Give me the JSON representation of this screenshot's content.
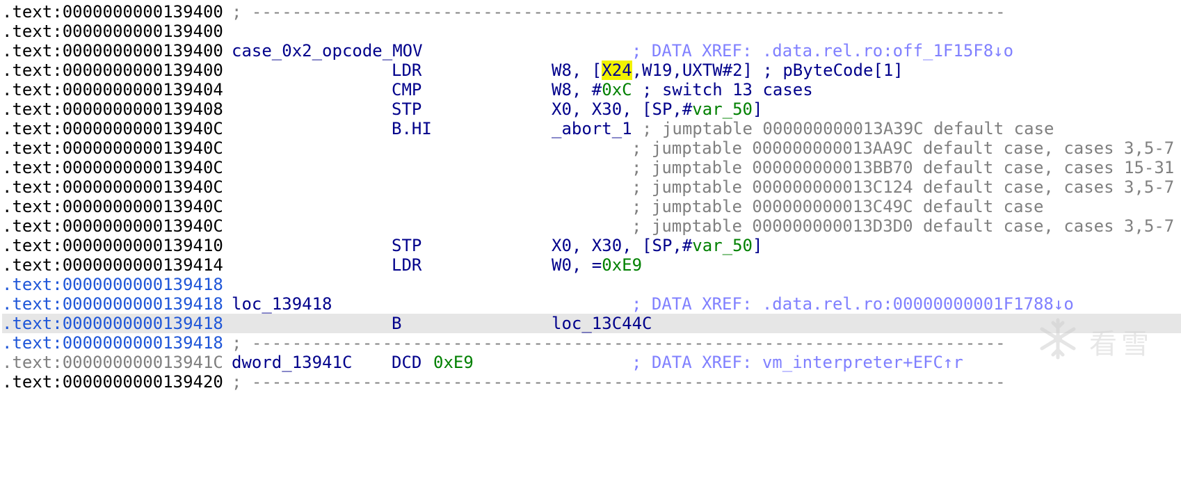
{
  "listing": {
    "rows": [
      {
        "addr": ".text:0000000000139400",
        "sep": "; ---------------------------------------------------------------------------"
      },
      {
        "addr": ".text:0000000000139400"
      },
      {
        "addr": ".text:0000000000139400",
        "label": "case_0x2_opcode_MOV",
        "comment": "; DATA XREF: .data.rel.ro:off_1F15F8↓o"
      },
      {
        "addr": ".text:0000000000139400",
        "mnem": "LDR",
        "ops_a": "W8, [",
        "ops_hl": "X24",
        "ops_b": ",W19,UXTW#2]",
        "ops_cmt": " ; pByteCode[1]"
      },
      {
        "addr": ".text:0000000000139404",
        "mnem": "CMP",
        "ops_a": "W8, #",
        "ops_num": "0xC",
        "ops_cmt": " ; switch 13 cases"
      },
      {
        "addr": ".text:0000000000139408",
        "mnem": "STP",
        "ops_a": "X0, X30, [SP,#",
        "ops_var": "var_50",
        "ops_b": "]"
      },
      {
        "addr": ".text:000000000013940C",
        "mnem": "B.HI",
        "ops_a": "_abort_1",
        "ops_cmt": " ; jumptable 000000000013A39C default case"
      },
      {
        "addr": ".text:000000000013940C",
        "comment": "; jumptable 000000000013AA9C default case, cases 3,5-7"
      },
      {
        "addr": ".text:000000000013940C",
        "comment": "; jumptable 000000000013BB70 default case, cases 15-31"
      },
      {
        "addr": ".text:000000000013940C",
        "comment": "; jumptable 000000000013C124 default case, cases 3,5-7"
      },
      {
        "addr": ".text:000000000013940C",
        "comment": "; jumptable 000000000013C49C default case"
      },
      {
        "addr": ".text:000000000013940C",
        "comment": "; jumptable 000000000013D3D0 default case, cases 3,5-7"
      },
      {
        "addr": ".text:0000000000139410",
        "mnem": "STP",
        "ops_a": "X0, X30, [SP,#",
        "ops_var": "var_50",
        "ops_b": "]"
      },
      {
        "addr": ".text:0000000000139414",
        "mnem": "LDR",
        "ops_a": "W0, =",
        "ops_num": "0xE9"
      },
      {
        "addr": ".text:0000000000139418"
      },
      {
        "addr": ".text:0000000000139418",
        "label": "loc_139418",
        "comment": "; DATA XREF: .data.rel.ro:00000000001F1788↓o"
      },
      {
        "addr": ".text:0000000000139418",
        "mnem": "B",
        "ops_a": "loc_13C44C"
      },
      {
        "addr": ".text:0000000000139418",
        "sep": "; ---------------------------------------------------------------------------"
      },
      {
        "addr": ".text:000000000013941C",
        "label": "dword_13941C",
        "mnem": "DCD",
        "ops_a": "0xE9",
        "comment": "; DATA XREF: vm_interpreter+EFC↑r"
      },
      {
        "addr": ".text:0000000000139420",
        "sep": "; ---------------------------------------------------------------------------"
      }
    ]
  },
  "watermark": {
    "text": "看雪",
    "icon": "snowflake-icon"
  },
  "colors": {
    "address_black": "#000000",
    "address_blue": "#1f56d8",
    "address_gray": "#7f7f7f",
    "code_navy": "#00008b",
    "number_green": "#008000",
    "xref_purple": "#8080ff",
    "comment_gray": "#808080",
    "highlight_yellow": "#f2f200",
    "current_line_bg": "#e6e6e6"
  }
}
